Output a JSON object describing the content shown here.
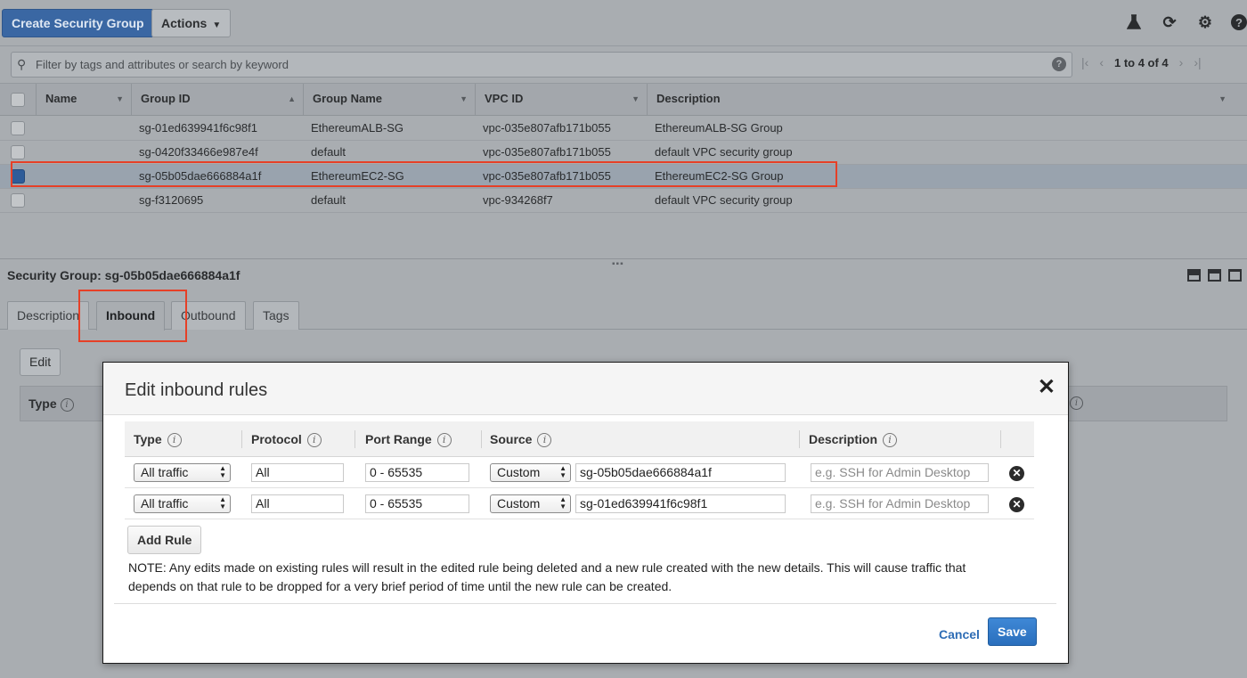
{
  "toolbar": {
    "create_label": "Create Security Group",
    "actions_label": "Actions",
    "icons": [
      "flask-icon",
      "refresh-icon",
      "gear-icon",
      "help-icon"
    ]
  },
  "filter": {
    "placeholder": "Filter by tags and attributes or search by keyword",
    "page_count": "1 to 4 of 4"
  },
  "grid": {
    "columns": [
      "Name",
      "Group ID",
      "Group Name",
      "VPC ID",
      "Description"
    ],
    "rows": [
      {
        "name": "",
        "group_id": "sg-01ed639941f6c98f1",
        "group_name": "EthereumALB-SG",
        "vpc_id": "vpc-035e807afb171b055",
        "description": "EthereumALB-SG Group",
        "selected": false
      },
      {
        "name": "",
        "group_id": "sg-0420f33466e987e4f",
        "group_name": "default",
        "vpc_id": "vpc-035e807afb171b055",
        "description": "default VPC security group",
        "selected": false
      },
      {
        "name": "",
        "group_id": "sg-05b05dae666884a1f",
        "group_name": "EthereumEC2-SG",
        "vpc_id": "vpc-035e807afb171b055",
        "description": "EthereumEC2-SG Group",
        "selected": true
      },
      {
        "name": "",
        "group_id": "sg-f3120695",
        "group_name": "default",
        "vpc_id": "vpc-934268f7",
        "description": "default VPC security group",
        "selected": false
      }
    ]
  },
  "details": {
    "title": "Security Group: sg-05b05dae666884a1f",
    "tabs": [
      "Description",
      "Inbound",
      "Outbound",
      "Tags"
    ],
    "active_tab": "Inbound",
    "edit_label": "Edit",
    "type_header": "Type"
  },
  "modal": {
    "title": "Edit inbound rules",
    "columns": [
      "Type",
      "Protocol",
      "Port Range",
      "Source",
      "Description"
    ],
    "rules": [
      {
        "type": "All traffic",
        "protocol": "All",
        "port_range": "0 - 65535",
        "source_type": "Custom",
        "source": "sg-05b05dae666884a1f",
        "description_placeholder": "e.g. SSH for Admin Desktop"
      },
      {
        "type": "All traffic",
        "protocol": "All",
        "port_range": "0 - 65535",
        "source_type": "Custom",
        "source": "sg-01ed639941f6c98f1",
        "description_placeholder": "e.g. SSH for Admin Desktop"
      }
    ],
    "add_rule_label": "Add Rule",
    "note": "NOTE: Any edits made on existing rules will result in the edited rule being deleted and a new rule created with the new details. This will cause traffic that depends on that rule to be dropped for a very brief period of time until the new rule can be created.",
    "cancel_label": "Cancel",
    "save_label": "Save"
  },
  "colors": {
    "highlight": "#e64027",
    "primary": "#2a6fbd",
    "link": "#2d6cb5"
  }
}
